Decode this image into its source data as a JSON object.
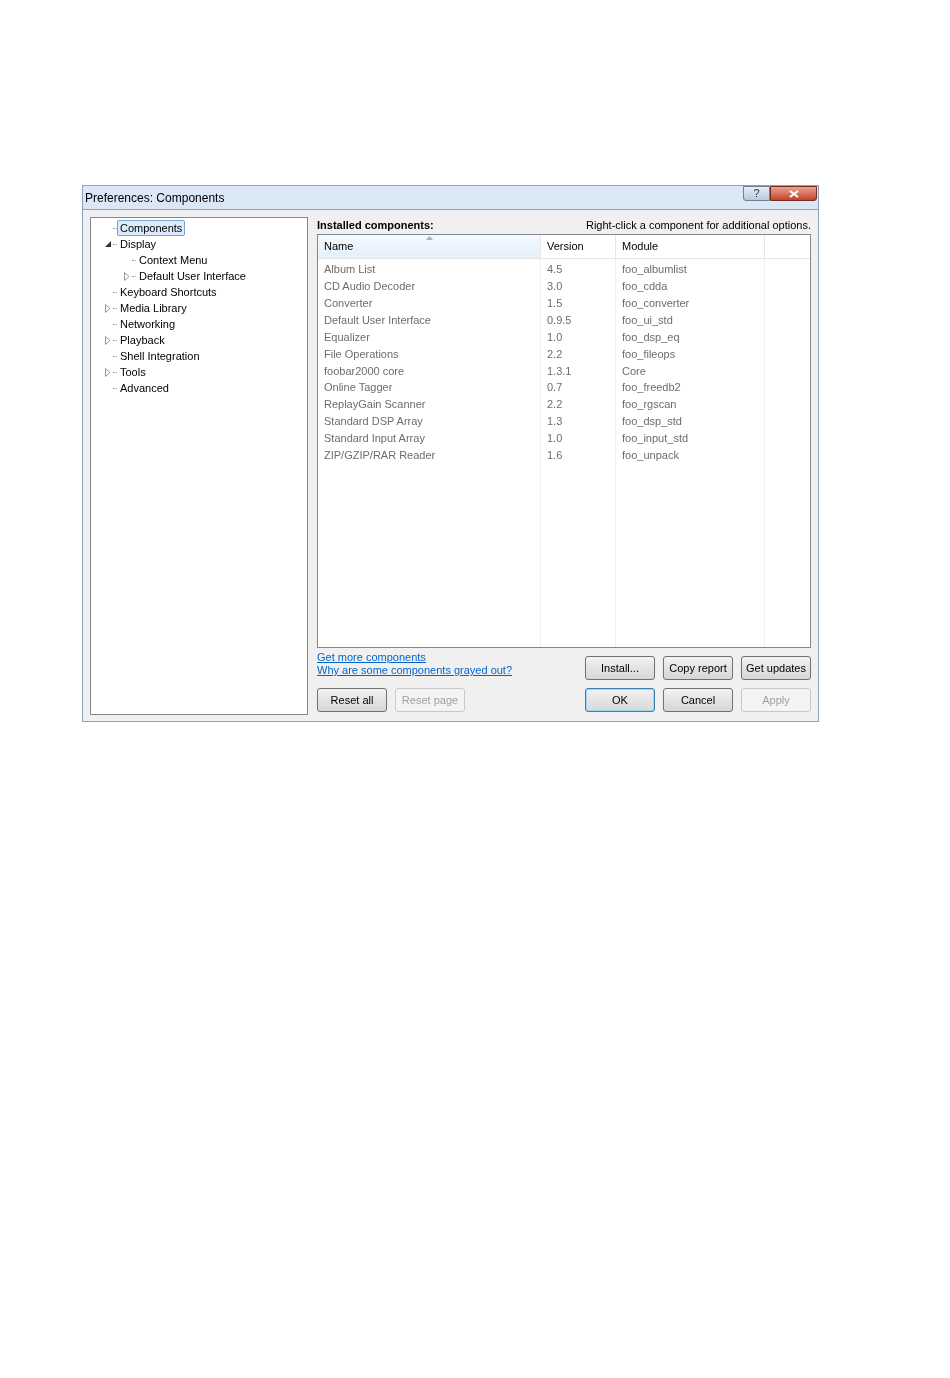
{
  "window": {
    "title": "Preferences: Components",
    "help_button": "?"
  },
  "tree": [
    {
      "label": "Components",
      "kind": "leaf",
      "selected": true
    },
    {
      "label": "Display",
      "kind": "branch",
      "expanded": true,
      "selected": false,
      "children": [
        {
          "label": "Context Menu",
          "kind": "leaf",
          "selected": false
        },
        {
          "label": "Default User Interface",
          "kind": "branch",
          "expanded": false,
          "selected": false
        }
      ]
    },
    {
      "label": "Keyboard Shortcuts",
      "kind": "leaf",
      "selected": false
    },
    {
      "label": "Media Library",
      "kind": "branch",
      "expanded": false,
      "selected": false
    },
    {
      "label": "Networking",
      "kind": "leaf",
      "selected": false
    },
    {
      "label": "Playback",
      "kind": "branch",
      "expanded": false,
      "selected": false
    },
    {
      "label": "Shell Integration",
      "kind": "leaf",
      "selected": false
    },
    {
      "label": "Tools",
      "kind": "branch",
      "expanded": false,
      "selected": false
    },
    {
      "label": "Advanced",
      "kind": "leaf",
      "selected": false
    }
  ],
  "panel": {
    "heading": "Installed components:",
    "hint": "Right-click a component for additional options."
  },
  "table": {
    "columns": [
      {
        "label": "Name",
        "sorted": true
      },
      {
        "label": "Version",
        "sorted": false
      },
      {
        "label": "Module",
        "sorted": false
      }
    ],
    "rows": [
      [
        "Album List",
        "4.5",
        "foo_albumlist"
      ],
      [
        "CD Audio Decoder",
        "3.0",
        "foo_cdda"
      ],
      [
        "Converter",
        "1.5",
        "foo_converter"
      ],
      [
        "Default User Interface",
        "0.9.5",
        "foo_ui_std"
      ],
      [
        "Equalizer",
        "1.0",
        "foo_dsp_eq"
      ],
      [
        "File Operations",
        "2.2",
        "foo_fileops"
      ],
      [
        "foobar2000 core",
        "1.3.1",
        "Core"
      ],
      [
        "Online Tagger",
        "0.7",
        "foo_freedb2"
      ],
      [
        "ReplayGain Scanner",
        "2.2",
        "foo_rgscan"
      ],
      [
        "Standard DSP Array",
        "1.3",
        "foo_dsp_std"
      ],
      [
        "Standard Input Array",
        "1.0",
        "foo_input_std"
      ],
      [
        "ZIP/GZIP/RAR Reader",
        "1.6",
        "foo_unpack"
      ]
    ]
  },
  "links": [
    "Get more components",
    "Why are some components grayed out?"
  ],
  "panel_buttons": [
    {
      "label": "Install...",
      "disabled": false,
      "default": false
    },
    {
      "label": "Copy report",
      "disabled": false,
      "default": false
    },
    {
      "label": "Get updates",
      "disabled": false,
      "default": false
    }
  ],
  "reset_buttons": [
    {
      "label": "Reset all",
      "disabled": false,
      "default": false
    },
    {
      "label": "Reset page",
      "disabled": true,
      "default": false
    }
  ],
  "dialog_buttons": [
    {
      "label": "OK",
      "disabled": false,
      "default": true
    },
    {
      "label": "Cancel",
      "disabled": false,
      "default": false
    },
    {
      "label": "Apply",
      "disabled": true,
      "default": false
    }
  ]
}
